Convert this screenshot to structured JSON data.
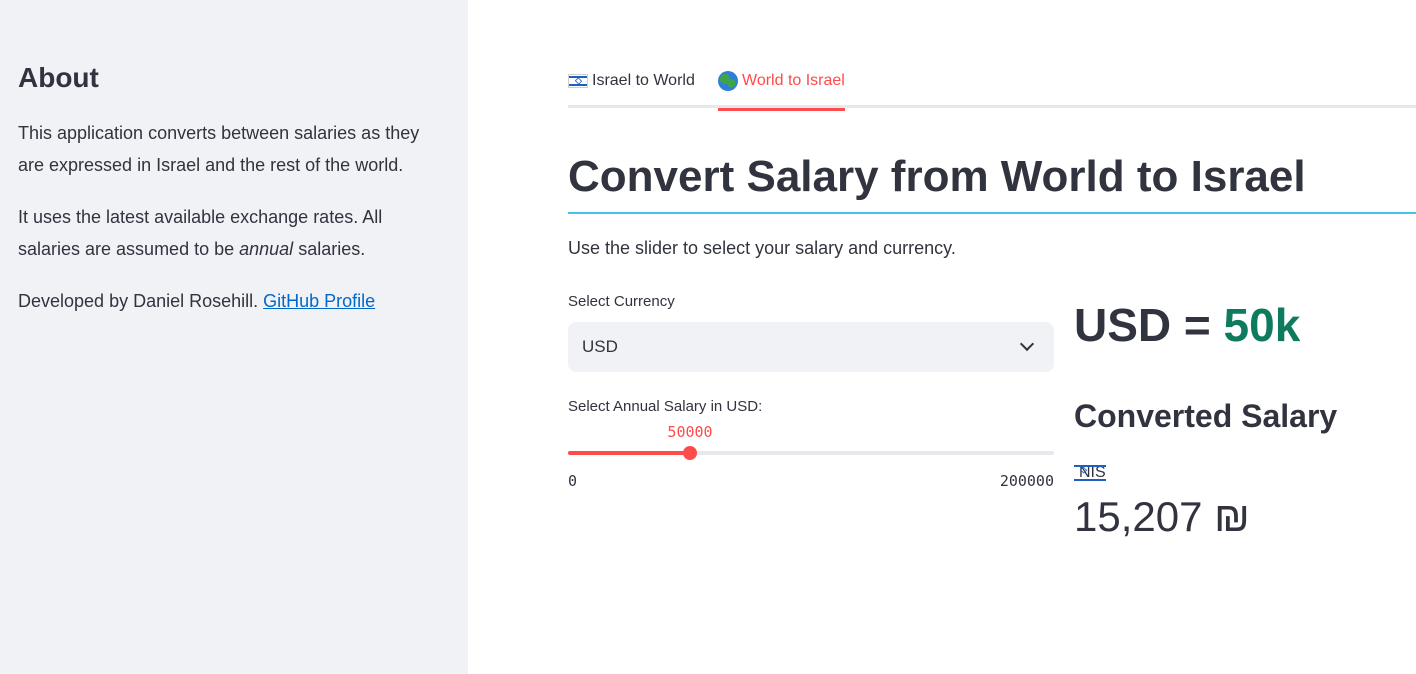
{
  "sidebar": {
    "heading": "About",
    "para1": "This application converts between salaries as they are expressed in Israel and the rest of the world.",
    "para2_before": "It uses the latest available exchange rates. All salaries are assumed to be ",
    "para2_em": "annual",
    "para2_after": " salaries.",
    "para3_before": "Developed by Daniel Rosehill. ",
    "para3_link": "GitHub Profile"
  },
  "tabs": [
    {
      "label": "Israel to World",
      "icon": "israel-flag-icon",
      "active": false
    },
    {
      "label": "World to Israel",
      "icon": "globe-icon",
      "active": true
    }
  ],
  "main": {
    "title": "Convert Salary from World to Israel",
    "intro": "Use the slider to select your salary and currency.",
    "currency_label": "Select Currency",
    "currency_value": "USD",
    "salary_label": "Select Annual Salary in USD:",
    "slider": {
      "value": 50000,
      "value_text": "50000",
      "min_text": "0",
      "max_text": "200000",
      "min": 0,
      "max": 200000
    },
    "result_prefix": "USD = ",
    "result_amount": "50k",
    "converted_title": "Converted Salary",
    "metric_label": "NIS",
    "metric_value": "15,207 ₪"
  },
  "colors": {
    "accent": "#ff4b4b",
    "result_accent": "#0e7a5e",
    "sidebar_bg": "#f0f2f6",
    "link": "#0068c9"
  }
}
